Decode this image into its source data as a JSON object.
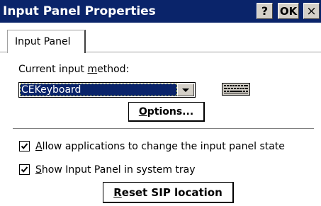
{
  "window": {
    "title": "Input Panel Properties",
    "help_label": "?",
    "ok_label": "OK",
    "close_label": "×",
    "title_bg": "#0a246a"
  },
  "tabs": [
    {
      "label": "Input Panel",
      "selected": true
    }
  ],
  "input_method": {
    "label_prefix": "Current input ",
    "label_underlined": "m",
    "label_suffix": "ethod:",
    "selected": "CEKeyboard",
    "icon": "keyboard-icon"
  },
  "options_button": {
    "underlined": "O",
    "rest": "ptions..."
  },
  "checkboxes": [
    {
      "underlined": "A",
      "rest": "llow applications to change the input panel state",
      "checked": true
    },
    {
      "underlined": "S",
      "rest": "how Input Panel in system tray",
      "checked": true
    }
  ],
  "reset_button": {
    "underlined": "R",
    "rest": "eset SIP location"
  }
}
